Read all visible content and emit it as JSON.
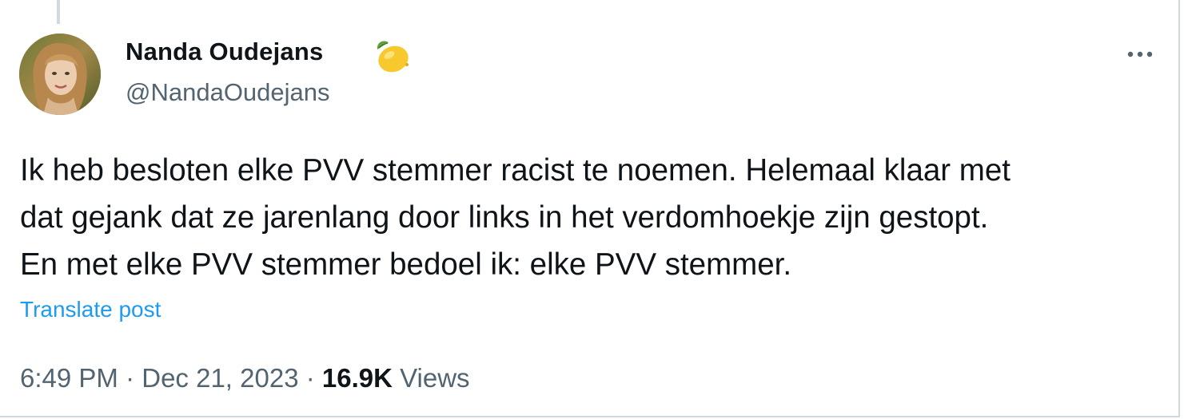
{
  "tweet": {
    "author": {
      "display_name": "Nanda Oudejans",
      "emoji": "lemon",
      "handle": "@NandaOudejans"
    },
    "more_icon": "more-horizontal-icon",
    "text_lines": [
      "Ik heb besloten elke PVV stemmer racist te noemen. Helemaal klaar met",
      "dat gejank dat ze jarenlang door links in het verdomhoekje zijn gestopt.",
      "En met elke PVV stemmer bedoel ik: elke PVV stemmer."
    ],
    "translate_label": "Translate post",
    "time": "6:49 PM",
    "separator": " · ",
    "date": "Dec 21, 2023",
    "views_count": "16.9K",
    "views_label": "Views"
  },
  "colors": {
    "text_primary": "#0f1419",
    "text_secondary": "#536471",
    "link": "#1d9bf0",
    "border": "#cfd9de"
  }
}
